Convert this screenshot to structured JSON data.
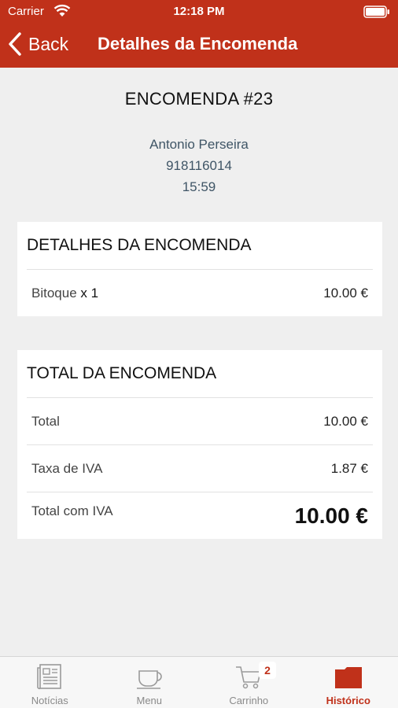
{
  "status_bar": {
    "carrier": "Carrier",
    "time": "12:18 PM"
  },
  "nav": {
    "back_label": "Back",
    "title": "Detalhes da Encomenda"
  },
  "order": {
    "title": "ENCOMENDA #23",
    "customer_name": "Antonio Perseira",
    "phone": "918116014",
    "time": "15:59"
  },
  "details_card": {
    "header": "DETALHES DA ENCOMENDA",
    "items": [
      {
        "name": "Bitoque",
        "qty": "x 1",
        "price": "10.00 €"
      }
    ]
  },
  "total_card": {
    "header": "TOTAL DA ENCOMENDA",
    "rows": [
      {
        "label": "Total",
        "value": "10.00 €"
      },
      {
        "label": "Taxa de IVA",
        "value": "1.87 €"
      },
      {
        "label": "Total com IVA",
        "value": "10.00 €"
      }
    ]
  },
  "tabbar": {
    "tabs": [
      {
        "label": "Notícias",
        "icon": "newspaper-icon"
      },
      {
        "label": "Menu",
        "icon": "coffee-cup-icon"
      },
      {
        "label": "Carrinho",
        "icon": "cart-icon",
        "badge": "2"
      },
      {
        "label": "Histórico",
        "icon": "history-folder-icon",
        "active": true
      }
    ]
  },
  "colors": {
    "accent": "#c0311a",
    "background": "#efefef",
    "card": "#ffffff"
  }
}
